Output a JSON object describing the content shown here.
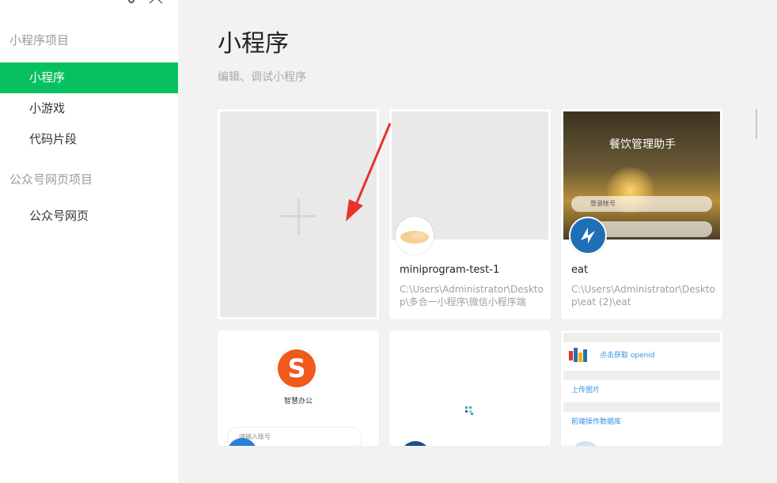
{
  "window": {
    "icons": [
      "gear-icon",
      "close-icon"
    ]
  },
  "sidebar": {
    "section1": "小程序项目",
    "items1": [
      {
        "label": "小程序",
        "active": true
      },
      {
        "label": "小游戏",
        "active": false
      },
      {
        "label": "代码片段",
        "active": false
      }
    ],
    "section2": "公众号网页项目",
    "items2": [
      {
        "label": "公众号网页",
        "active": false
      }
    ]
  },
  "main": {
    "title": "小程序",
    "subtitle": "编辑、调试小程序"
  },
  "projects": [
    {
      "name": "miniprogram-test-1",
      "path": "C:\\Users\\Administrator\\Desktop\\多合一小程序\\微信小程序端"
    },
    {
      "name": "eat",
      "path": "C:\\Users\\Administrator\\Desktop\\eat (2)\\eat",
      "thumbnail": {
        "title": "餐饮管理助手",
        "field1": "登录帐号"
      }
    }
  ],
  "bottom_cards": {
    "card1": {
      "caption": "智慧办公",
      "login": "请输入账号"
    },
    "card3": {
      "row1": "点击获取 openid",
      "row2": "上传图片",
      "row3": "前端操作数据库"
    }
  },
  "colors": {
    "accent": "#07c160",
    "arrow": "#e8322e"
  }
}
